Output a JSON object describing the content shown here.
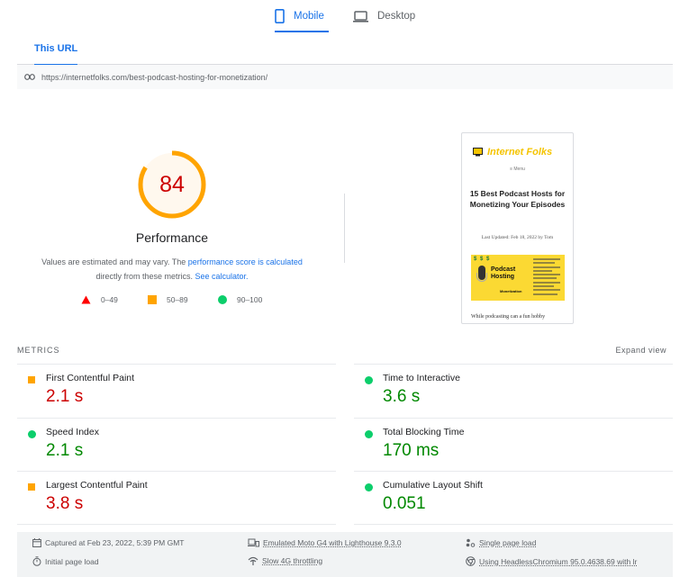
{
  "device_tabs": [
    {
      "label": "Mobile",
      "icon": "phone-icon",
      "active": true
    },
    {
      "label": "Desktop",
      "icon": "desktop-icon",
      "active": false
    }
  ],
  "url_tab": {
    "label": "This URL",
    "active": true
  },
  "url": "https://internetfolks.com/best-podcast-hosting-for-monetization/",
  "gauge": {
    "score": "84",
    "score_fraction": 0.84,
    "label": "Performance",
    "color": "#ffa400",
    "fill": "#fff8ee",
    "text_color": "#cc0000"
  },
  "description": {
    "prefix": "Values are estimated and may vary. The ",
    "link1": "performance score is calculated",
    "middle": " directly from these metrics. ",
    "link2": "See calculator."
  },
  "legend": [
    {
      "symbol": "triangle",
      "range": "0–49",
      "color": "#ff0000"
    },
    {
      "symbol": "square",
      "range": "50–89",
      "color": "#ffa400"
    },
    {
      "symbol": "circle",
      "range": "90–100",
      "color": "#0cce6b"
    }
  ],
  "thumbnail": {
    "brand": "Internet Folks",
    "menu": "≡ Menu",
    "title": "15 Best Podcast Hosts for Monetizing Your Episodes",
    "updated": "Last Updated: Feb 18, 2022 by Tom",
    "banner_dollars": "$ $ $",
    "banner_title": "Podcast Hosting",
    "banner_sub": "Monetization",
    "snippet": "While podcasting can a fun hobby"
  },
  "metrics": {
    "header": "METRICS",
    "expand_label": "Expand view",
    "left": [
      {
        "name": "First Contentful Paint",
        "value": "2.1 s",
        "rating": "average"
      },
      {
        "name": "Speed Index",
        "value": "2.1 s",
        "rating": "pass"
      },
      {
        "name": "Largest Contentful Paint",
        "value": "3.8 s",
        "rating": "average"
      }
    ],
    "right": [
      {
        "name": "Time to Interactive",
        "value": "3.6 s",
        "rating": "pass"
      },
      {
        "name": "Total Blocking Time",
        "value": "170 ms",
        "rating": "pass"
      },
      {
        "name": "Cumulative Layout Shift",
        "value": "0.051",
        "rating": "pass"
      }
    ]
  },
  "info": {
    "captured": "Captured at Feb 23, 2022, 5:39 PM GMT",
    "initial_load": "Initial page load",
    "emulated": "Emulated Moto G4 with Lighthouse 9.3.0",
    "throttling": "Slow 4G throttling",
    "single_load": "Single page load",
    "browser": "Using HeadlessChromium 95.0.4638.69 with lr"
  }
}
